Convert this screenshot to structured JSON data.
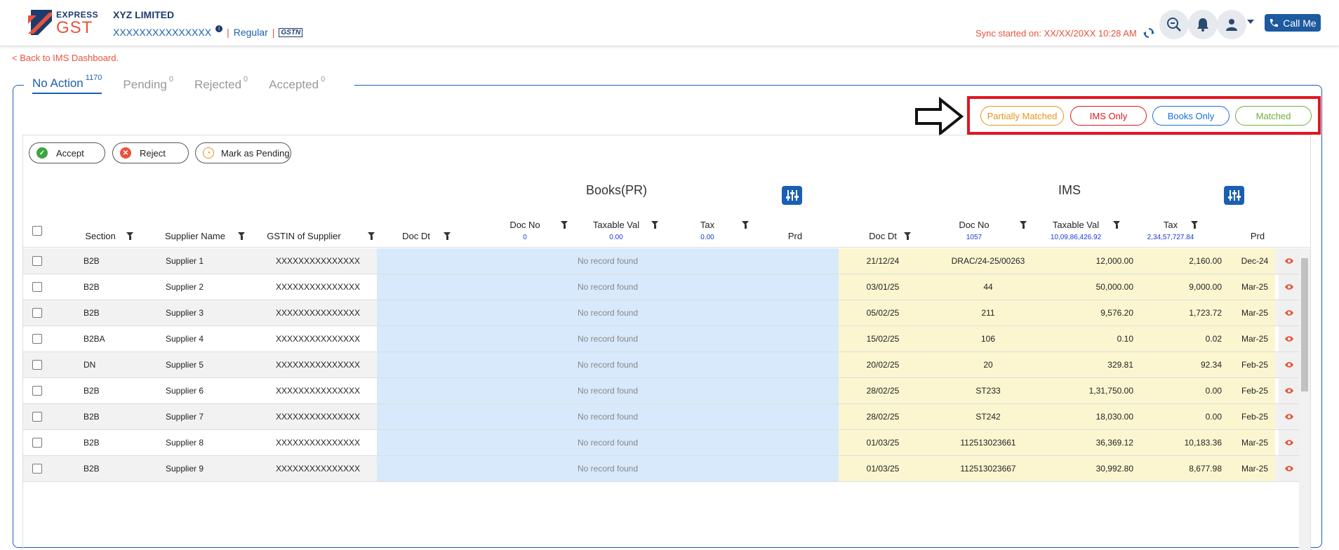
{
  "header": {
    "logo_top": "EXPRESS",
    "logo_bottom": "GST",
    "company": "XYZ LIMITED",
    "gstin": "XXXXXXXXXXXXXXX",
    "category": "Regular",
    "gstn_badge": "GSTN",
    "sync_text": "Sync started on: XX/XX/20XX 10:28 AM",
    "call_label": "Call Me",
    "icons": [
      "search-zoom-icon",
      "bell-icon",
      "user-icon",
      "phone-icon",
      "sync-icon"
    ]
  },
  "back_link": "< Back to IMS Dashboard.",
  "tabs": [
    {
      "label": "No Action",
      "count": "1170"
    },
    {
      "label": "Pending",
      "count": "0"
    },
    {
      "label": "Rejected",
      "count": "0"
    },
    {
      "label": "Accepted",
      "count": "0"
    }
  ],
  "filters": [
    {
      "label": "Partially Matched",
      "color": "#e89419"
    },
    {
      "label": "IMS Only",
      "color": "#e3161e"
    },
    {
      "label": "Books Only",
      "color": "#1a6fe0"
    },
    {
      "label": "Matched",
      "color": "#6fb13a"
    }
  ],
  "actions": {
    "accept": "Accept",
    "reject": "Reject",
    "pending": "Mark as Pending"
  },
  "groups": {
    "books": "Books(PR)",
    "ims": "IMS"
  },
  "columns": {
    "section": "Section",
    "supplier": "Supplier Name",
    "gstin": "GSTIN of Supplier",
    "b_docdt": "Doc Dt",
    "b_docno": "Doc No",
    "b_taxable": "Taxable Val",
    "b_tax": "Tax",
    "b_prd": "Prd",
    "i_docdt": "Doc Dt",
    "i_docno": "Doc No",
    "i_taxable": "Taxable Val",
    "i_tax": "Tax",
    "i_prd": "Prd"
  },
  "totals": {
    "b_docno": "0",
    "b_taxable": "0.00",
    "b_tax": "0.00",
    "i_docno": "1057",
    "i_taxable": "10,09,86,426.92",
    "i_tax": "2,34,57,727.84"
  },
  "no_record": "No record found",
  "rows": [
    {
      "section": "B2B",
      "supplier": "Supplier 1",
      "gstin": "XXXXXXXXXXXXXXX",
      "docdt": "21/12/24",
      "docno": "DRAC/24-25/00263",
      "taxable": "12,000.00",
      "tax": "2,160.00",
      "prd": "Dec-24"
    },
    {
      "section": "B2B",
      "supplier": "Supplier 2",
      "gstin": "XXXXXXXXXXXXXXX",
      "docdt": "03/01/25",
      "docno": "44",
      "taxable": "50,000.00",
      "tax": "9,000.00",
      "prd": "Mar-25"
    },
    {
      "section": "B2B",
      "supplier": "Supplier 3",
      "gstin": "XXXXXXXXXXXXXXX",
      "docdt": "05/02/25",
      "docno": "211",
      "taxable": "9,576.20",
      "tax": "1,723.72",
      "prd": "Mar-25"
    },
    {
      "section": "B2BA",
      "supplier": "Supplier 4",
      "gstin": "XXXXXXXXXXXXXXX",
      "docdt": "15/02/25",
      "docno": "106",
      "taxable": "0.10",
      "tax": "0.02",
      "prd": "Mar-25"
    },
    {
      "section": "DN",
      "supplier": "Supplier 5",
      "gstin": "XXXXXXXXXXXXXXX",
      "docdt": "20/02/25",
      "docno": "20",
      "taxable": "329.81",
      "tax": "92.34",
      "prd": "Feb-25"
    },
    {
      "section": "B2B",
      "supplier": "Supplier 6",
      "gstin": "XXXXXXXXXXXXXXX",
      "docdt": "28/02/25",
      "docno": "ST233",
      "taxable": "1,31,750.00",
      "tax": "0.00",
      "prd": "Feb-25"
    },
    {
      "section": "B2B",
      "supplier": "Supplier 7",
      "gstin": "XXXXXXXXXXXXXXX",
      "docdt": "28/02/25",
      "docno": "ST242",
      "taxable": "18,030.00",
      "tax": "0.00",
      "prd": "Feb-25"
    },
    {
      "section": "B2B",
      "supplier": "Supplier 8",
      "gstin": "XXXXXXXXXXXXXXX",
      "docdt": "01/03/25",
      "docno": "112513023661",
      "taxable": "36,369.12",
      "tax": "10,183.36",
      "prd": "Mar-25"
    },
    {
      "section": "B2B",
      "supplier": "Supplier 9",
      "gstin": "XXXXXXXXXXXXXXX",
      "docdt": "01/03/25",
      "docno": "112513023667",
      "taxable": "30,992.80",
      "tax": "8,677.98",
      "prd": "Mar-25"
    }
  ]
}
